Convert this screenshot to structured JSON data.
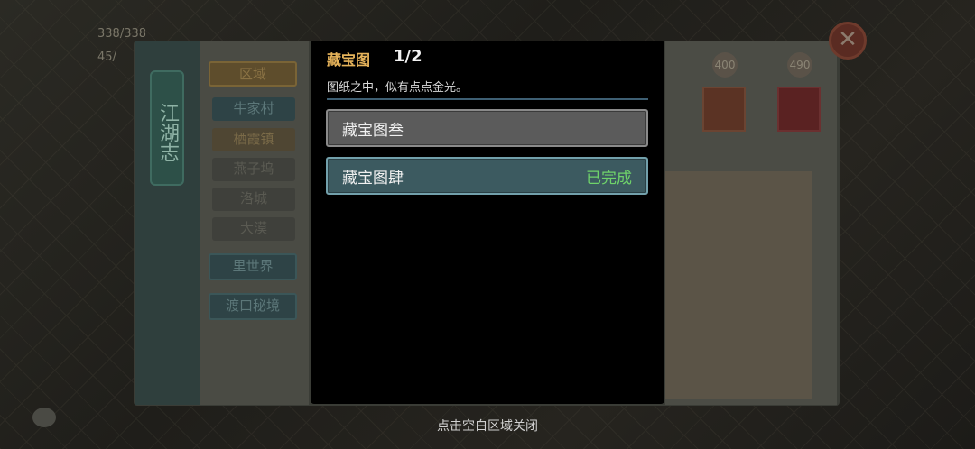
{
  "background": {
    "hp_value": "338/338",
    "stamina_value": "45/",
    "book_title": "江湖志",
    "region_header": "区域",
    "regions": [
      "牛家村",
      "栖霞镇",
      "燕子坞",
      "洛城",
      "大漠"
    ],
    "special_buttons": [
      "里世界",
      "渡口秘境"
    ],
    "scores": [
      "400",
      "490"
    ]
  },
  "dialog": {
    "title": "藏宝图",
    "count": "1/2",
    "description": "图纸之中，似有点点金光。",
    "entries": [
      {
        "label": "藏宝图叁",
        "status": ""
      },
      {
        "label": "藏宝图肆",
        "status": "已完成"
      }
    ]
  },
  "footer": {
    "hint": "点击空白区域关闭"
  },
  "colors": {
    "title_gold": "#e6b35a",
    "complete_green": "#6fd36a",
    "selected_teal": "#3c5a60"
  }
}
